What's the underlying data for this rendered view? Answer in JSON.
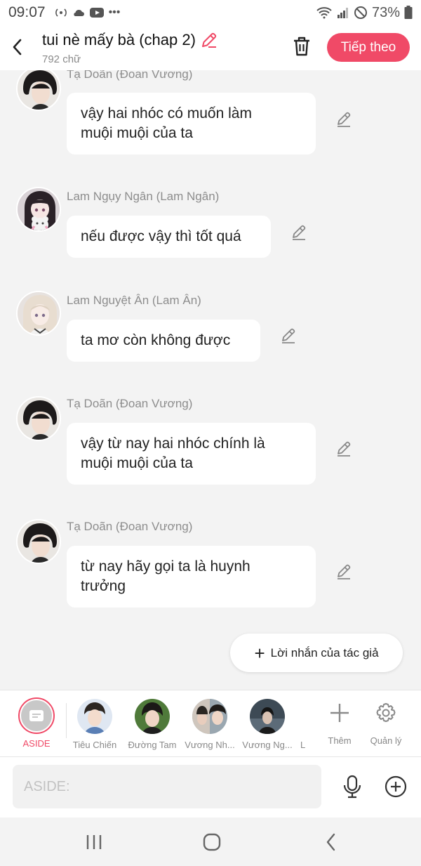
{
  "status": {
    "time": "09:07",
    "battery": "73%"
  },
  "header": {
    "title": "tui nè mấy bà (chap 2)",
    "word_count": "792 chữ",
    "next_label": "Tiếp theo"
  },
  "messages": [
    {
      "sender": "Tạ Doãn (Đoan Vương)",
      "text_lines": [
        "vậy hai nhóc có muốn làm",
        "muội muội của ta"
      ]
    },
    {
      "sender": "Lam Ngụy Ngân (Lam Ngân)",
      "text_lines": [
        "nếu được vậy thì tốt quá"
      ]
    },
    {
      "sender": "Lam Nguyệt Ân (Lam Ân)",
      "text_lines": [
        "ta mơ còn không được"
      ]
    },
    {
      "sender": "Tạ Doãn (Đoan Vương)",
      "text_lines": [
        "vậy từ nay hai nhóc chính là",
        "muội muội của ta"
      ]
    },
    {
      "sender": "Tạ Doãn (Đoan Vương)",
      "text_lines": [
        "từ nay hãy gọi ta là huynh",
        "trưởng"
      ]
    }
  ],
  "author_note_label": "Lời nhắn của tác giả",
  "characters": {
    "aside_label": "ASIDE",
    "items": [
      {
        "name": "Tiêu Chiến"
      },
      {
        "name": "Đường Tam"
      },
      {
        "name": "Vương Nh..."
      },
      {
        "name": "Vương Ng..."
      },
      {
        "name": "L"
      }
    ],
    "add_label": "Thêm",
    "manage_label": "Quản lý"
  },
  "input": {
    "placeholder": "ASIDE:"
  },
  "colors": {
    "accent": "#f04a67",
    "bubble": "#ffffff",
    "background": "#f3f3f3"
  }
}
